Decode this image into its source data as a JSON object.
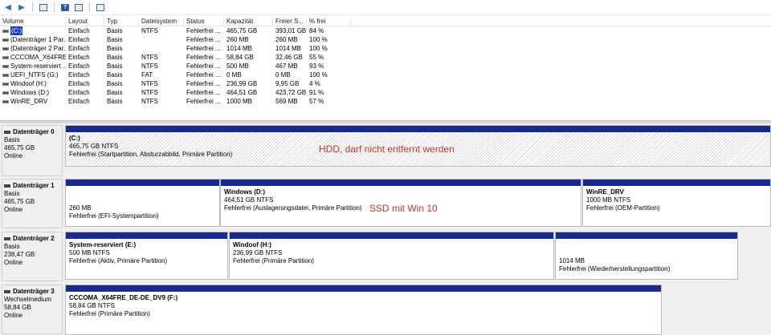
{
  "toolbar": {
    "buttons": [
      "back-icon",
      "forward-icon",
      "properties-icon",
      "help-icon",
      "view-icon",
      "list-icon"
    ]
  },
  "volume_list": {
    "columns": [
      "Volume",
      "Layout",
      "Typ",
      "Dateisystem",
      "Status",
      "Kapazität",
      "Freier S...",
      "% frei"
    ],
    "rows": [
      {
        "volume": "(C:)",
        "layout": "Einfach",
        "typ": "Basis",
        "fs": "NTFS",
        "status": "Fehlerfrei ...",
        "cap": "465,75 GB",
        "free": "393,01 GB",
        "pct": "84 %"
      },
      {
        "volume": "(Datenträger 1 Par...",
        "layout": "Einfach",
        "typ": "Basis",
        "fs": "",
        "status": "Fehlerfrei ...",
        "cap": "260 MB",
        "free": "260 MB",
        "pct": "100 %"
      },
      {
        "volume": "(Datenträger 2 Par...",
        "layout": "Einfach",
        "typ": "Basis",
        "fs": "",
        "status": "Fehlerfrei ...",
        "cap": "1014 MB",
        "free": "1014 MB",
        "pct": "100 %"
      },
      {
        "volume": "CCCOMA_X64FRE...",
        "layout": "Einfach",
        "typ": "Basis",
        "fs": "NTFS",
        "status": "Fehlerfrei ...",
        "cap": "58,84 GB",
        "free": "32,46 GB",
        "pct": "55 %"
      },
      {
        "volume": "System-reserviert ...",
        "layout": "Einfach",
        "typ": "Basis",
        "fs": "NTFS",
        "status": "Fehlerfrei ...",
        "cap": "500 MB",
        "free": "467 MB",
        "pct": "93 %"
      },
      {
        "volume": "UEFI_NTFS (G:)",
        "layout": "Einfach",
        "typ": "Basis",
        "fs": "FAT",
        "status": "Fehlerfrei ...",
        "cap": "0 MB",
        "free": "0 MB",
        "pct": "100 %"
      },
      {
        "volume": "Windoof (H:)",
        "layout": "Einfach",
        "typ": "Basis",
        "fs": "NTFS",
        "status": "Fehlerfrei ...",
        "cap": "236,99 GB",
        "free": "9,95 GB",
        "pct": "4 %"
      },
      {
        "volume": "Windows (D:)",
        "layout": "Einfach",
        "typ": "Basis",
        "fs": "NTFS",
        "status": "Fehlerfrei ...",
        "cap": "464,51 GB",
        "free": "423,72 GB",
        "pct": "91 %"
      },
      {
        "volume": "WinRE_DRV",
        "layout": "Einfach",
        "typ": "Basis",
        "fs": "NTFS",
        "status": "Fehlerfrei ...",
        "cap": "1000 MB",
        "free": "569 MB",
        "pct": "57 %"
      }
    ]
  },
  "disks": [
    {
      "name": "Datenträger 0",
      "type": "Basis",
      "size": "465,75 GB",
      "state": "Online",
      "partitions": [
        {
          "title": "(C:)",
          "size": "465,75 GB NTFS",
          "status": "Fehlerfrei (Startpartition, Absturzabbild, Primäre Partition)"
        }
      ]
    },
    {
      "name": "Datenträger 1",
      "type": "Basis",
      "size": "465,75 GB",
      "state": "Online",
      "partitions": [
        {
          "title": "",
          "size": "260 MB",
          "status": "Fehlerfrei (EFI-Systempartition)"
        },
        {
          "title": "Windows  (D:)",
          "size": "464,51 GB NTFS",
          "status": "Fehlerfrei (Auslagerungsdatei, Primäre Partition)"
        },
        {
          "title": "WinRE_DRV",
          "size": "1000 MB NTFS",
          "status": "Fehlerfrei (OEM-Partition)"
        }
      ]
    },
    {
      "name": "Datenträger 2",
      "type": "Basis",
      "size": "238,47 GB",
      "state": "Online",
      "partitions": [
        {
          "title": "System-reserviert  (E:)",
          "size": "500 MB NTFS",
          "status": "Fehlerfrei (Aktiv, Primäre Partition)"
        },
        {
          "title": "Windoof  (H:)",
          "size": "236,99 GB NTFS",
          "status": "Fehlerfrei (Primäre Partition)"
        },
        {
          "title": "",
          "size": "1014 MB",
          "status": "Fehlerfrei (Wiederherstellungspartition)"
        }
      ]
    },
    {
      "name": "Datenträger 3",
      "type": "Wechselmedium",
      "size": "58,84 GB",
      "state": "Online",
      "partitions": [
        {
          "title": "CCCOMA_X64FRE_DE-DE_DV9  (F:)",
          "size": "58,84 GB NTFS",
          "status": "Fehlerfrei (Primäre Partition)"
        }
      ]
    }
  ],
  "annotations": {
    "hdd": "HDD, darf nicht entfernt werden",
    "ssd": "SSD mit Win 10"
  },
  "colors": {
    "partition_bar": "#1a2a8c",
    "annotation": "#c0392b",
    "selection": "#1c3fbd"
  }
}
